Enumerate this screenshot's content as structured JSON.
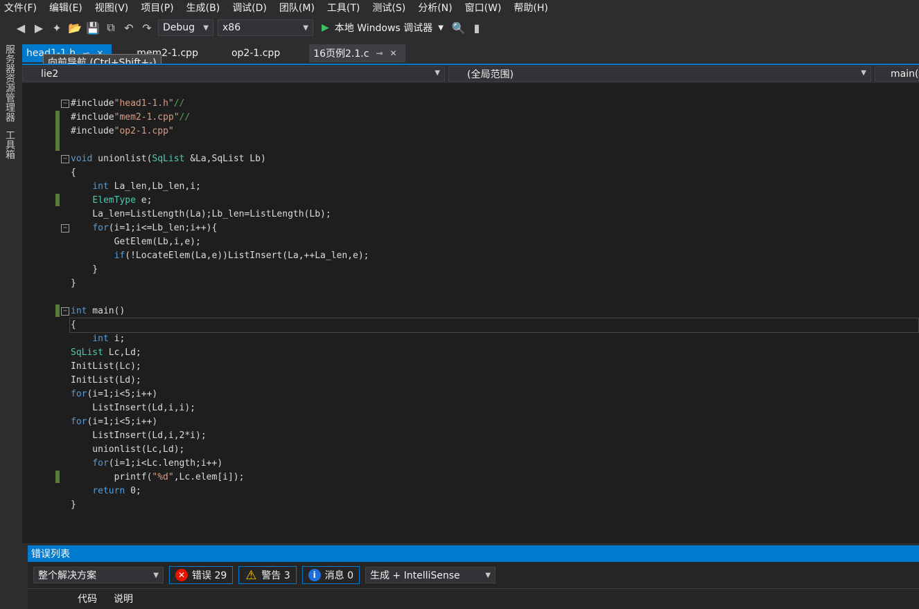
{
  "menu": [
    "文件(F)",
    "编辑(E)",
    "视图(V)",
    "项目(P)",
    "生成(B)",
    "调试(D)",
    "团队(M)",
    "工具(T)",
    "测试(S)",
    "分析(N)",
    "窗口(W)",
    "帮助(H)"
  ],
  "toolbar": {
    "config": "Debug",
    "platform": "x86",
    "run_label": "本地 Windows 调试器"
  },
  "side_tabs": [
    "服务器资源管理器",
    "工具箱"
  ],
  "tabs": {
    "t1": "head1-1.h",
    "t2": "mem2-1.cpp",
    "t3": "op2-1.cpp",
    "t4": "16页例2.1.c"
  },
  "tooltip": "向前导航 (Ctrl+Shift+-)",
  "nav": {
    "project": "lie2",
    "scope": "(全局范围)",
    "member": "main("
  },
  "error_list": {
    "title": "错误列表",
    "scope_filter": "整个解决方案",
    "errors_label": "错误 29",
    "warnings_label": "警告 3",
    "messages_label": "消息 0",
    "source_filter": "生成 + IntelliSense",
    "col_code": "代码",
    "col_desc": "说明"
  }
}
